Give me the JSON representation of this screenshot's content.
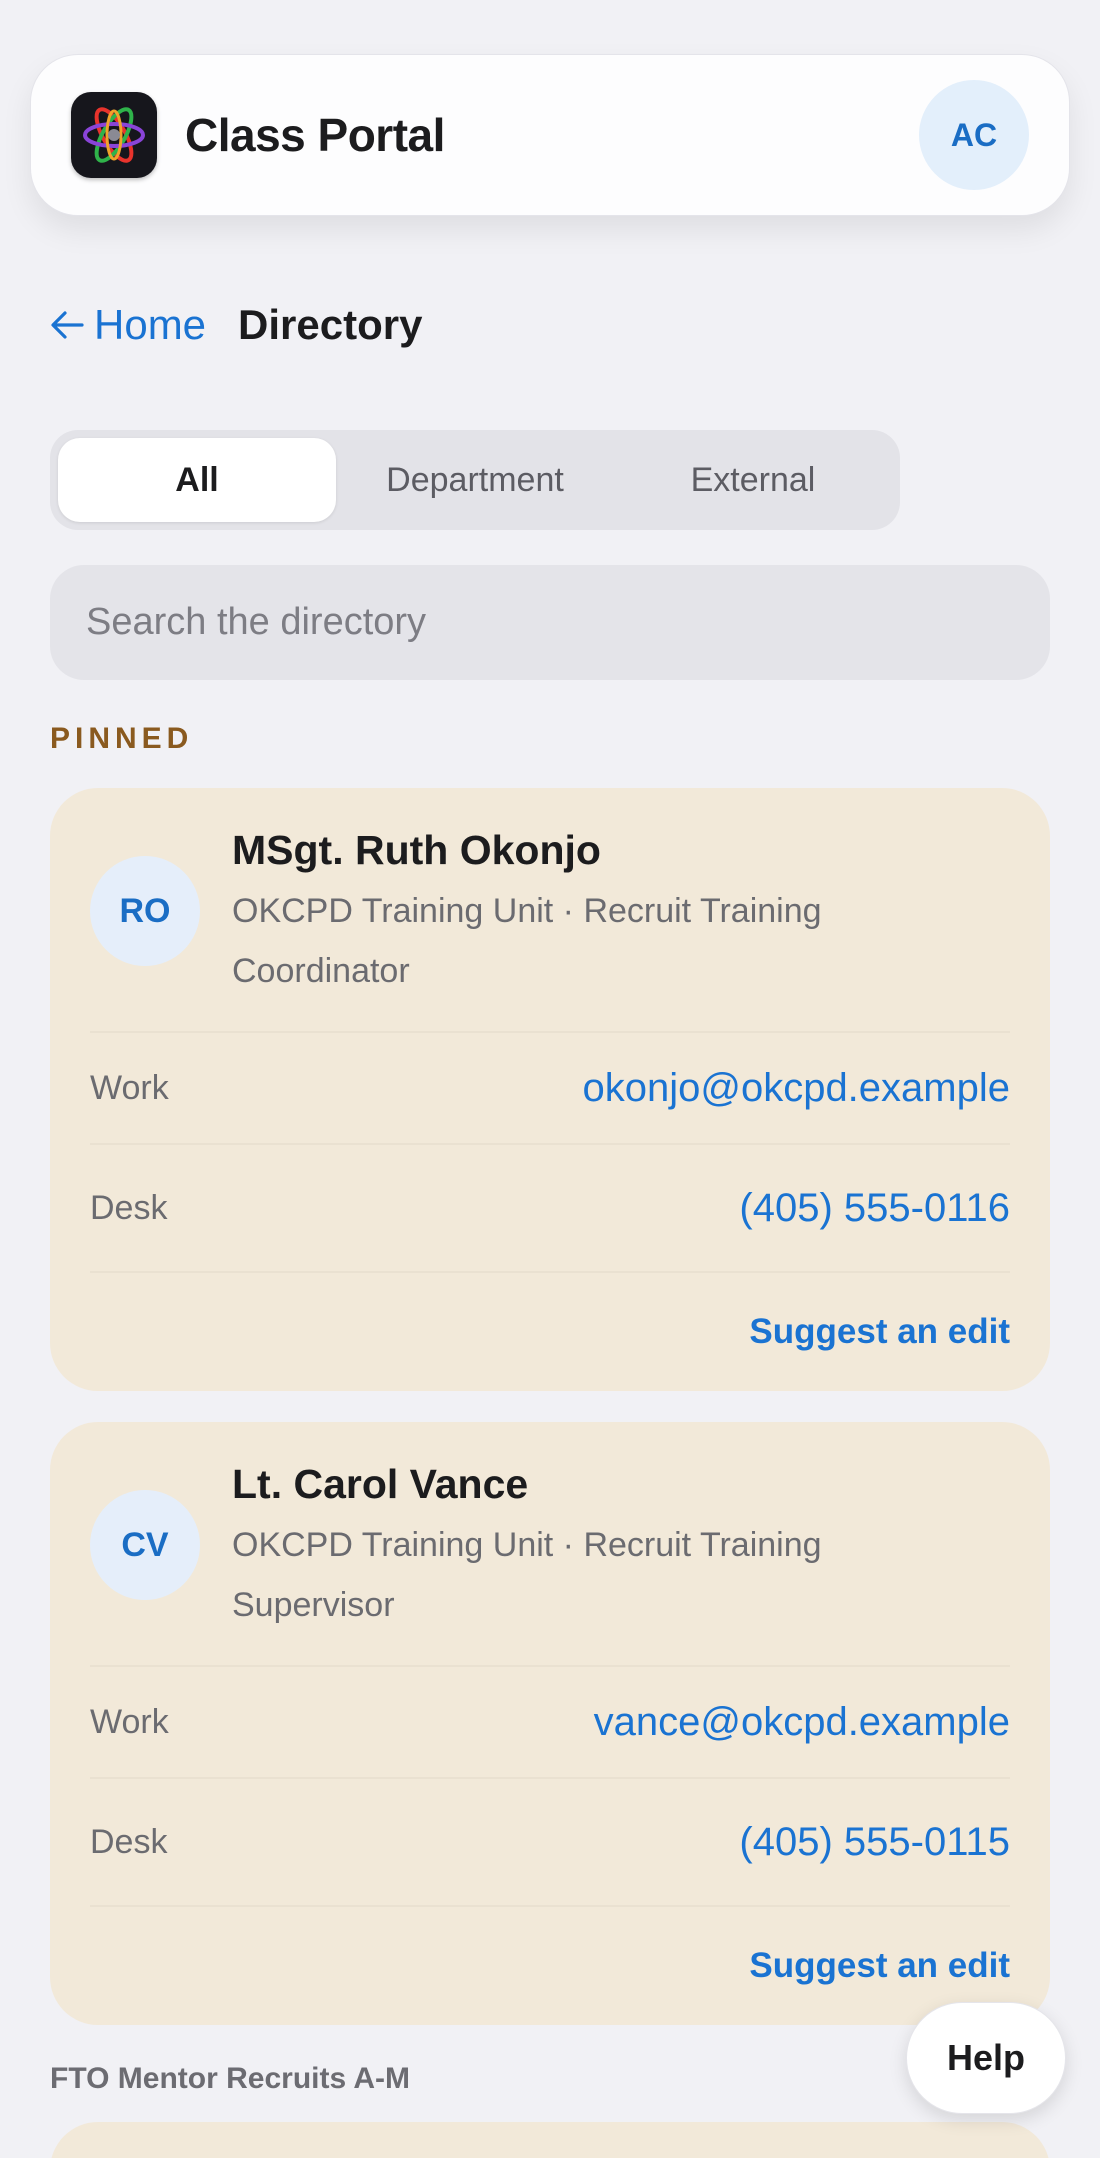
{
  "app": {
    "title": "Class Portal",
    "icon": "atom-icon",
    "user_initials": "AC"
  },
  "breadcrumb": {
    "back_label": "Home",
    "current": "Directory"
  },
  "tabs": [
    {
      "label": "All",
      "active": true
    },
    {
      "label": "Department",
      "active": false
    },
    {
      "label": "External",
      "active": false
    }
  ],
  "search": {
    "placeholder": "Search the directory",
    "value": ""
  },
  "pinned": {
    "label": "PINNED",
    "contacts": [
      {
        "initials": "RO",
        "name": "MSgt. Ruth Okonjo",
        "role": "OKCPD Training Unit · Recruit Training Coordinator",
        "work_label": "Work",
        "work": "okonjo@okcpd.example",
        "desk_label": "Desk",
        "desk": "(405) 555-0116",
        "action": "Suggest an edit"
      },
      {
        "initials": "CV",
        "name": "Lt. Carol Vance",
        "role": "OKCPD Training Unit · Recruit Training Supervisor",
        "work_label": "Work",
        "work": "vance@okcpd.example",
        "desk_label": "Desk",
        "desk": "(405) 555-0115",
        "action": "Suggest an edit"
      }
    ]
  },
  "group": {
    "label": "FTO Mentor Recruits A-M"
  },
  "help": {
    "label": "Help"
  },
  "colors": {
    "accent": "#1a73d2",
    "card_bg": "#f2e9d9",
    "pinned_label": "#8a5a1f",
    "page_bg": "#f1f1f5"
  }
}
